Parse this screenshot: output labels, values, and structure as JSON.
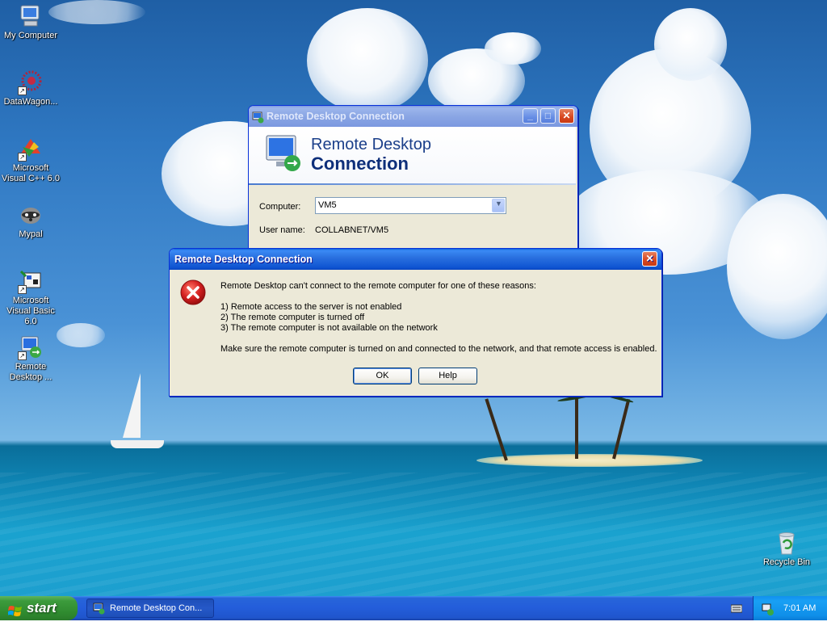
{
  "desktop": {
    "icons": [
      {
        "label": "My Computer",
        "icon": "my-computer-icon"
      },
      {
        "label": "DataWagon...",
        "icon": "datawagon-icon"
      },
      {
        "label": "Microsoft Visual C++ 6.0",
        "icon": "visual-cpp-icon"
      },
      {
        "label": "Mypal",
        "icon": "mypal-raccoon-icon"
      },
      {
        "label": "Microsoft Visual Basic 6.0",
        "icon": "visual-basic-icon"
      },
      {
        "label": "Remote Desktop ...",
        "icon": "remote-desktop-icon"
      },
      {
        "label": "Recycle Bin",
        "icon": "recycle-bin-icon"
      }
    ]
  },
  "rdc_window": {
    "title": "Remote Desktop Connection",
    "banner_line1": "Remote Desktop",
    "banner_line2": "Connection",
    "computer_label": "Computer:",
    "computer_value": "VM5",
    "username_label": "User name:",
    "username_value": "COLLABNET/VM5"
  },
  "error_dialog": {
    "title": "Remote Desktop Connection",
    "message": "Remote Desktop can't connect to the remote computer for one of these reasons:",
    "reasons": [
      "1) Remote access to the server is not enabled",
      "2) The remote computer is turned off",
      "3) The remote computer is not available on the network"
    ],
    "advice": "Make sure the remote computer is turned on and connected to the network, and that remote access is enabled.",
    "ok_label": "OK",
    "help_label": "Help"
  },
  "taskbar": {
    "start_label": "start",
    "task_item_label": "Remote Desktop Con...",
    "clock": "7:01 AM"
  },
  "colors": {
    "title_active": "#0a5fd8",
    "title_inactive": "#7a96df",
    "dialog_face": "#ece9d8",
    "error_red": "#d42020",
    "start_green": "#3c9b3c"
  }
}
